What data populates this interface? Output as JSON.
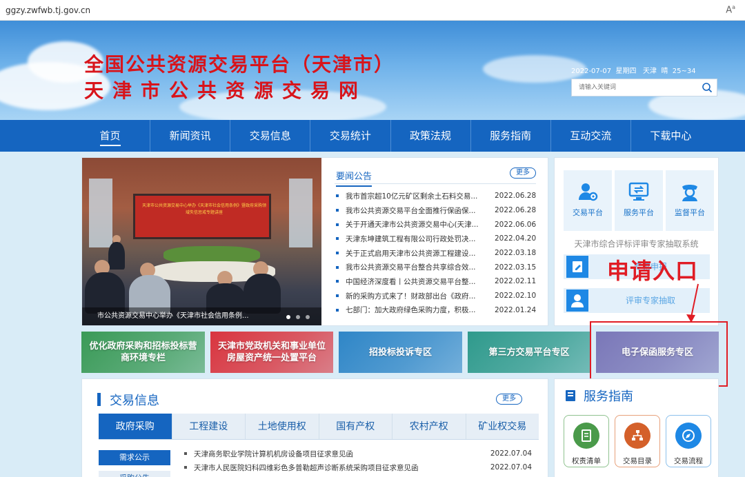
{
  "browser": {
    "url": "ggzy.zwfwb.tj.gov.cn",
    "reader_icon": "A⁰"
  },
  "header": {
    "title_line1": "全国公共资源交易平台（天津市）",
    "title_line2": "天津市公共资源交易网",
    "date": "2022-07-07",
    "weekday": "星期四",
    "city": "天津",
    "weather": "晴",
    "temp": "25~34",
    "search_placeholder": "请输入关键词"
  },
  "nav": {
    "items": [
      "首页",
      "新闻资讯",
      "交易信息",
      "交易统计",
      "政策法规",
      "服务指南",
      "互动交流",
      "下载中心"
    ],
    "active": 0
  },
  "carousel": {
    "caption": "市公共资源交易中心举办《天津市社会信用条例...",
    "screen_text": "天津市公共资源交易中心举办《天津市社会信用条例》暨政府采购领域失信惩戒专题讲座",
    "slides": 3,
    "current": 1
  },
  "announcements": {
    "title": "要闻公告",
    "more": "更多",
    "items": [
      {
        "text": "我市首宗超10亿元矿区剩余土石料交易...",
        "date": "2022.06.28"
      },
      {
        "text": "我市公共资源交易平台全面推行保函保...",
        "date": "2022.06.28"
      },
      {
        "text": "关于开通天津市公共资源交易中心(天津...",
        "date": "2022.06.06"
      },
      {
        "text": "天津东坤建筑工程有限公司行政处罚决...",
        "date": "2022.04.20"
      },
      {
        "text": "关于正式启用天津市公共资源工程建设...",
        "date": "2022.03.18"
      },
      {
        "text": "我市公共资源交易平台整合共享综合效...",
        "date": "2022.03.15"
      },
      {
        "text": "中国经济深度看丨公共资源交易平台整...",
        "date": "2022.02.11"
      },
      {
        "text": "新的采购方式来了！财政部出台《政府...",
        "date": "2022.02.10"
      },
      {
        "text": "七部门：加大政府绿色采购力度，积极...",
        "date": "2022.01.24"
      }
    ]
  },
  "platforms": {
    "items": [
      "交易平台",
      "服务平台",
      "监督平台"
    ],
    "expert_system_title": "天津市综合评标评审专家抽取系统",
    "btn_register": "专家申报",
    "btn_extract": "评审专家抽取"
  },
  "annotation": {
    "label": "申请入口",
    "color": "#e01c24"
  },
  "tiles": [
    {
      "label": "优化政府采购和招标投标营商环境专栏",
      "color": "#3a9a57"
    },
    {
      "label": "天津市党政机关和事业单位房屋资产统一处置平台",
      "color": "#d9353f"
    },
    {
      "label": "招投标投诉专区",
      "color": "#2f86c7"
    },
    {
      "label": "第三方交易平台专区",
      "color": "#2f9a8c"
    },
    {
      "label": "电子保函服务专区",
      "color": "#7a77b8"
    }
  ],
  "trade": {
    "title": "交易信息",
    "more": "更多",
    "tabs": [
      "政府采购",
      "工程建设",
      "土地使用权",
      "国有产权",
      "农村产权",
      "矿业权交易"
    ],
    "active_tab": 0,
    "sub_buttons": [
      "需求公示",
      "采购公告"
    ],
    "items": [
      {
        "text": "天津商务职业学院计算机机房设备项目征求意见函",
        "date": "2022.07.04"
      },
      {
        "text": "天津市人民医院妇科四维彩色多普勒超声诊断系统采购项目征求意见函",
        "date": "2022.07.04"
      }
    ]
  },
  "guide": {
    "title": "服务指南",
    "cards": [
      {
        "label": "权责清单",
        "color": "#4a9a4a",
        "icon": "doc-icon"
      },
      {
        "label": "交易目录",
        "color": "#d4602a",
        "icon": "tree-icon"
      },
      {
        "label": "交易流程",
        "color": "#1e88e5",
        "icon": "compass-icon"
      }
    ]
  },
  "colors": {
    "nav_blue": "#1565c0",
    "title_red": "#d8141b"
  }
}
